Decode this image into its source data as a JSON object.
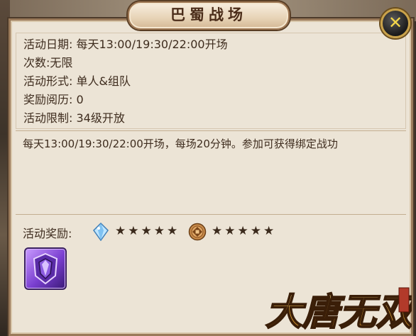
{
  "title": "巴蜀战场",
  "close_icon": "close-icon",
  "info": {
    "date_label": "活动日期:",
    "date_value": "每天13:00/19:30/22:00开场",
    "count_text": "次数:无限",
    "form_label": "活动形式:",
    "form_value": "单人&组队",
    "exp_label": "奖励阅历:",
    "exp_value": "0",
    "limit_label": "活动限制:",
    "limit_value": "34级开放"
  },
  "description": "每天13:00/19:30/22:00开场，每场20分钟。参加可获得绑定战功",
  "rewards": {
    "label": "活动奖励:",
    "items": [
      {
        "icon": "blue-gem-icon",
        "stars": 5,
        "stars_text": "★★★★★"
      },
      {
        "icon": "bronze-coin-icon",
        "stars": 5,
        "stars_text": "★★★★★"
      }
    ],
    "slot_icon": "purple-shield-icon"
  },
  "logo_text": "大唐无双",
  "colors": {
    "panel_bg": "#ece4d6",
    "border": "#9a7a5a",
    "text": "#3e2c1e",
    "logo_gold": "#d8a531"
  }
}
